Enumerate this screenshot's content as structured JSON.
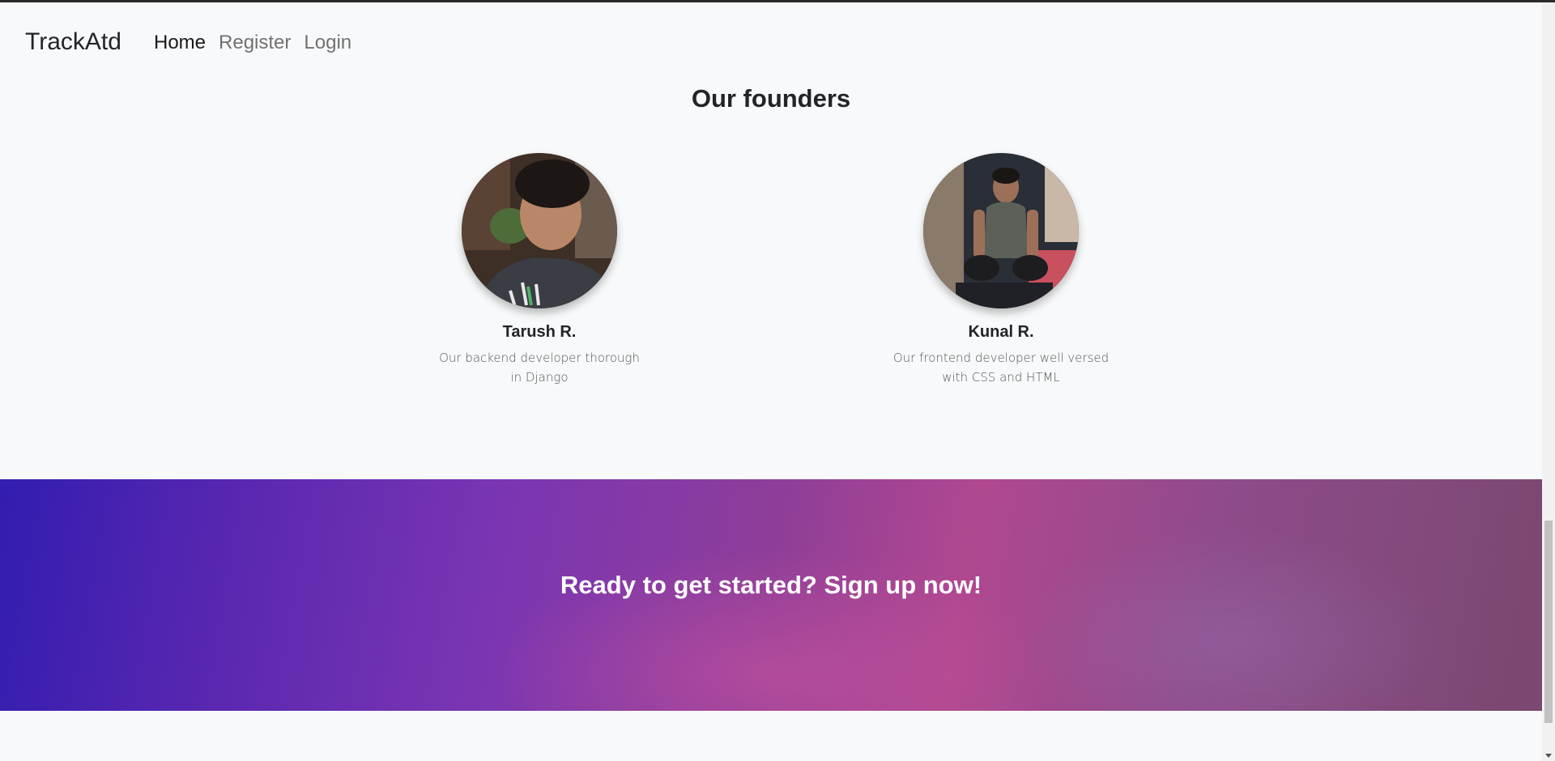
{
  "navbar": {
    "brand": "TrackAtd",
    "links": [
      {
        "label": "Home",
        "active": true
      },
      {
        "label": "Register",
        "active": false
      },
      {
        "label": "Login",
        "active": false
      }
    ]
  },
  "founders": {
    "title": "Our founders",
    "items": [
      {
        "name": "Tarush R.",
        "description": "Our backend developer thorough in Django"
      },
      {
        "name": "Kunal R.",
        "description": "Our frontend developer well versed with CSS and HTML"
      }
    ]
  },
  "cta": {
    "title": "Ready to get started? Sign up now!"
  },
  "colors": {
    "background": "#f8f9fa",
    "text": "#212529",
    "cta_gradient_start": "#321db0",
    "cta_gradient_mid": "#8f3e98",
    "cta_gradient_end": "#7a4870"
  }
}
